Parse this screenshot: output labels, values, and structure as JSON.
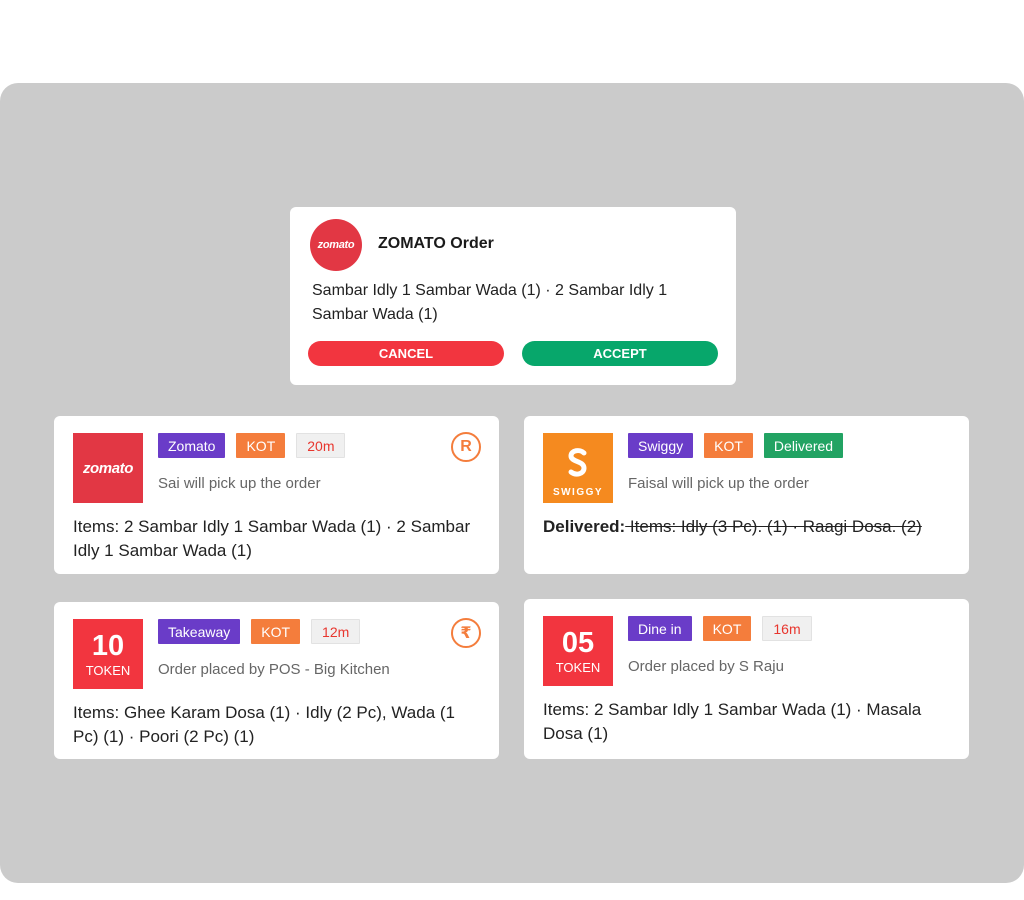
{
  "notification": {
    "logo_text": "zomato",
    "title": "ZOMATO Order",
    "items": "Sambar Idly 1 Sambar Wada (1) · 2 Sambar Idly 1 Sambar Wada (1)",
    "cancel_label": "CANCEL",
    "accept_label": "ACCEPT"
  },
  "orders": [
    {
      "logo_text": "zomato",
      "tags": [
        "Zomato",
        "KOT",
        "20m"
      ],
      "subtitle": "Sai will pick up the order",
      "items": "Items: 2 Sambar Idly 1 Sambar Wada (1) · 2 Sambar Idly 1 Sambar Wada (1)",
      "payment_icon": "R"
    },
    {
      "logo_text": "SWIGGY",
      "tags": [
        "Swiggy",
        "KOT",
        "Delivered"
      ],
      "subtitle": "Faisal will pick up the order",
      "items_prefix": "Delivered:",
      "items": " Items: Idly (3 Pc). (1) · Raagi Dosa. (2)"
    },
    {
      "token_number": "10",
      "token_label": "TOKEN",
      "tags": [
        "Takeaway",
        "KOT",
        "12m"
      ],
      "subtitle": "Order placed by POS - Big Kitchen",
      "items": "Items: Ghee Karam Dosa (1) · Idly (2 Pc), Wada (1 Pc) (1) · Poori (2 Pc) (1)",
      "payment_icon": "₹"
    },
    {
      "token_number": "05",
      "token_label": "TOKEN",
      "tags": [
        "Dine in",
        "KOT",
        "16m"
      ],
      "subtitle": "Order placed by S Raju",
      "items": "Items: 2 Sambar Idly 1 Sambar Wada (1) · Masala Dosa (1)"
    }
  ],
  "colors": {
    "panel_bg": "#cbcbcb",
    "zomato_red": "#e23744",
    "swiggy_orange": "#f58a1f",
    "token_red": "#f2353f",
    "tag_purple": "#6a3cc8",
    "tag_orange": "#f47d3c",
    "tag_green": "#22a363",
    "cancel_red": "#f2353f",
    "accept_green": "#07a76b"
  }
}
